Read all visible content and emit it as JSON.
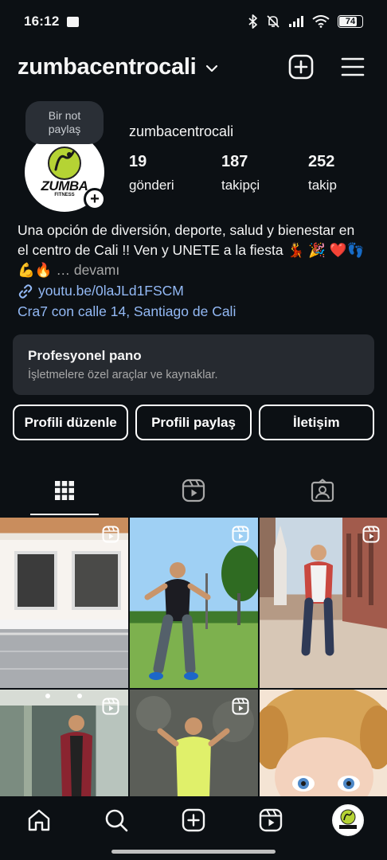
{
  "status_bar": {
    "time": "16:12",
    "battery": "74",
    "icons": [
      "message-icon",
      "bluetooth-icon",
      "mute-icon",
      "signal-icon",
      "wifi-icon",
      "battery-icon"
    ]
  },
  "header": {
    "username": "zumbacentrocali",
    "icons": [
      "chevron-down-icon",
      "create-icon",
      "menu-icon"
    ]
  },
  "note": {
    "text": "Bir not paylaş"
  },
  "avatar": {
    "brand": "ZUMBA",
    "sub": "FITNESS"
  },
  "profile": {
    "name": "zumbacentrocali",
    "stats": [
      {
        "value": "19",
        "label": "gönderi"
      },
      {
        "value": "187",
        "label": "takipçi"
      },
      {
        "value": "252",
        "label": "takip"
      }
    ]
  },
  "bio": {
    "text": "Una opción de diversión, deporte, salud y bienestar en el centro de Cali !! Ven y UNETE a la fiesta 💃 🎉 ❤️👣💪🔥",
    "more": "… devamı",
    "link": "youtu.be/0laJLd1FSCM",
    "address": "Cra7 con calle 14, Santiago de Cali"
  },
  "dashboard": {
    "title": "Profesyonel pano",
    "subtitle": "İşletmelere özel araçlar ve kaynaklar."
  },
  "buttons": {
    "edit": "Profili düzenle",
    "share": "Profili paylaş",
    "contact": "İletişim"
  },
  "tabs": [
    "grid-icon",
    "reels-icon",
    "tagged-icon"
  ],
  "grid": {
    "count": 6,
    "type": "reels"
  },
  "bottom_nav": [
    "home-icon",
    "search-icon",
    "create-icon",
    "reels-icon",
    "profile-avatar"
  ],
  "colors": {
    "background": "#0c1014",
    "link": "#93b9f5",
    "card": "#262a30",
    "zumba_green": "#b5d334"
  }
}
